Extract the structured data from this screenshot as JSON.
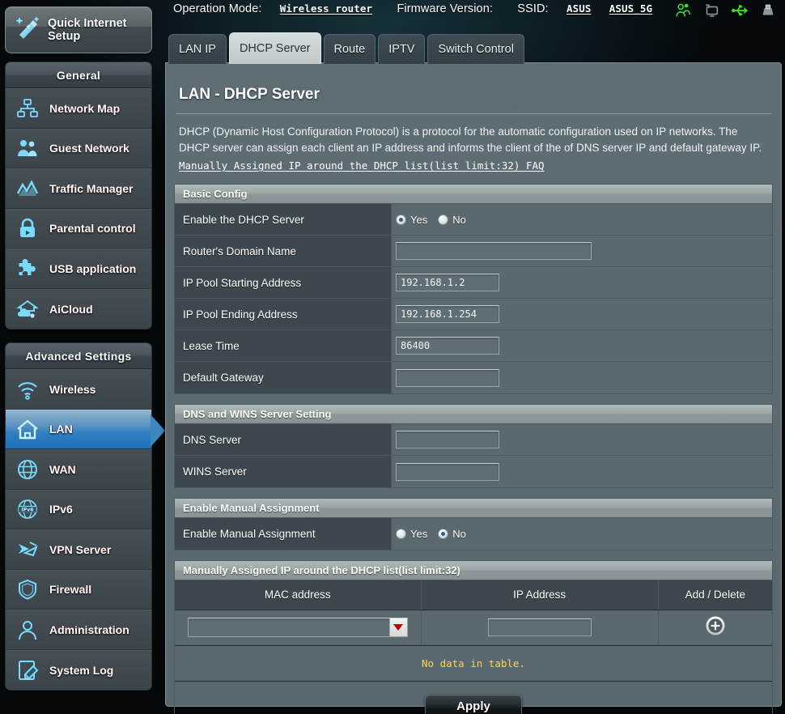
{
  "header": {
    "operation_mode_label": "Operation Mode:",
    "operation_mode_value": "Wireless router",
    "firmware_label": "Firmware Version:",
    "firmware_value": "",
    "ssid_label": "SSID:",
    "ssid_value_1": "ASUS",
    "ssid_value_2": "ASUS_5G",
    "tray_icons": [
      "clients-icon",
      "usb-devices-icon",
      "usb-icon",
      "printer-icon"
    ]
  },
  "quick_setup": {
    "label": "Quick Internet\nSetup",
    "line1": "Quick Internet",
    "line2": "Setup",
    "icon": "magic-wand-icon"
  },
  "sidebar": {
    "general": {
      "title": "General",
      "items": [
        {
          "label": "Network Map",
          "icon": "network-map-icon",
          "active": false
        },
        {
          "label": "Guest Network",
          "icon": "guest-network-icon",
          "active": false
        },
        {
          "label": "Traffic Manager",
          "icon": "traffic-manager-icon",
          "active": false
        },
        {
          "label": "Parental control",
          "icon": "parental-control-icon",
          "active": false
        },
        {
          "label": "USB application",
          "icon": "usb-application-icon",
          "active": false
        },
        {
          "label": "AiCloud",
          "icon": "aicloud-icon",
          "active": false
        }
      ]
    },
    "advanced": {
      "title": "Advanced Settings",
      "items": [
        {
          "label": "Wireless",
          "icon": "wireless-icon",
          "active": false
        },
        {
          "label": "LAN",
          "icon": "lan-home-icon",
          "active": true
        },
        {
          "label": "WAN",
          "icon": "wan-globe-icon",
          "active": false
        },
        {
          "label": "IPv6",
          "icon": "ipv6-icon",
          "active": false
        },
        {
          "label": "VPN Server",
          "icon": "vpn-server-icon",
          "active": false
        },
        {
          "label": "Firewall",
          "icon": "firewall-shield-icon",
          "active": false
        },
        {
          "label": "Administration",
          "icon": "administration-user-icon",
          "active": false
        },
        {
          "label": "System Log",
          "icon": "system-log-icon",
          "active": false
        }
      ]
    }
  },
  "tabs": [
    {
      "label": "LAN IP",
      "active": false
    },
    {
      "label": "DHCP Server",
      "active": true
    },
    {
      "label": "Route",
      "active": false
    },
    {
      "label": "IPTV",
      "active": false
    },
    {
      "label": "Switch Control",
      "active": false
    }
  ],
  "main": {
    "title": "LAN - DHCP Server",
    "description": "DHCP (Dynamic Host Configuration Protocol) is a protocol for the automatic configuration used on IP networks. The DHCP server can assign each client an IP address and informs the client of the of DNS server IP and default gateway IP.",
    "faq_link": "Manually Assigned IP around the DHCP list(list limit:32) FAQ",
    "sections": {
      "basic": {
        "header": "Basic Config",
        "rows": {
          "enable_dhcp": {
            "label": "Enable the DHCP Server",
            "yes_label": "Yes",
            "no_label": "No",
            "selected": "Yes"
          },
          "domain_name": {
            "label": "Router's Domain Name",
            "value": "",
            "placeholder": ""
          },
          "pool_start": {
            "label": "IP Pool Starting Address",
            "value": "192.168.1.2",
            "placeholder": ""
          },
          "pool_end": {
            "label": "IP Pool Ending Address",
            "value": "192.168.1.254",
            "placeholder": ""
          },
          "lease_time": {
            "label": "Lease Time",
            "value": "86400",
            "placeholder": ""
          },
          "default_gateway": {
            "label": "Default Gateway",
            "value": "",
            "placeholder": ""
          }
        }
      },
      "dns_wins": {
        "header": "DNS and WINS Server Setting",
        "rows": {
          "dns_server": {
            "label": "DNS Server",
            "value": "",
            "placeholder": ""
          },
          "wins_server": {
            "label": "WINS Server",
            "value": "",
            "placeholder": ""
          }
        }
      },
      "manual_assignment": {
        "header": "Enable Manual Assignment",
        "rows": {
          "enable_manual": {
            "label": "Enable Manual Assignment",
            "yes_label": "Yes",
            "no_label": "No",
            "selected": "No"
          }
        }
      },
      "manual_list": {
        "header": "Manually Assigned IP around the DHCP list(list limit:32)",
        "columns": [
          "MAC address",
          "IP Address",
          "Add / Delete"
        ],
        "input_row": {
          "mac_value": "",
          "ip_value": "",
          "add_icon": "add-circle-icon"
        },
        "empty_message": "No data in table.",
        "rows": []
      }
    },
    "apply_label": "Apply"
  },
  "colors": {
    "accent_blue": "#2f7fc1",
    "icon_cyan": "#6fd8ff",
    "panel_bg": "#5a686f",
    "label_bg": "#3c484e",
    "section_head": "#9aa4a5",
    "warning_yellow": "#ffd34d",
    "dropdown_arrow_red": "#c00000",
    "tray_green": "#36e02a"
  }
}
